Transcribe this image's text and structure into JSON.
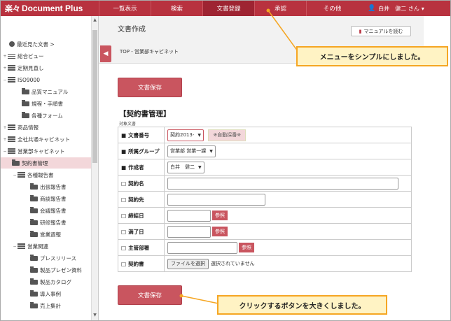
{
  "app": {
    "logo_mark": "楽々",
    "logo_text": "Document Plus"
  },
  "nav": [
    {
      "label": "一覧表示"
    },
    {
      "label": "検索"
    },
    {
      "label": "文書登録"
    },
    {
      "label": "承認"
    },
    {
      "label": "その他"
    }
  ],
  "user": {
    "name": "白井　健二 さん",
    "caret": "▾"
  },
  "sidebar": {
    "items": [
      {
        "label": "最近見た文書 >",
        "icon": "clock-icon"
      },
      {
        "label": "総合ビュー",
        "icon": "list-icon"
      },
      {
        "label": "定期見直し",
        "icon": "cabinet-icon"
      },
      {
        "label": "ISO9000",
        "icon": "cabinet-icon"
      },
      {
        "label": "品質マニュアル",
        "icon": "folder-icon"
      },
      {
        "label": "規程・手順書",
        "icon": "folder-icon"
      },
      {
        "label": "各種フォーム",
        "icon": "folder-icon"
      },
      {
        "label": "商品情報",
        "icon": "cabinet-icon"
      },
      {
        "label": "全社共通キャビネット",
        "icon": "cabinet-icon"
      },
      {
        "label": "営業部キャビネット",
        "icon": "cabinet-icon"
      },
      {
        "label": "契約書管理",
        "icon": "folder-icon"
      },
      {
        "label": "各種報告書",
        "icon": "cabinet-icon"
      },
      {
        "label": "出張報告書",
        "icon": "folder-icon"
      },
      {
        "label": "商談報告書",
        "icon": "folder-icon"
      },
      {
        "label": "会議報告書",
        "icon": "folder-icon"
      },
      {
        "label": "研修報告書",
        "icon": "folder-icon"
      },
      {
        "label": "営業週報",
        "icon": "folder-icon"
      },
      {
        "label": "営業関連",
        "icon": "cabinet-icon"
      },
      {
        "label": "プレスリリース",
        "icon": "folder-icon"
      },
      {
        "label": "製品プレゼン資料",
        "icon": "folder-icon"
      },
      {
        "label": "製品カタログ",
        "icon": "folder-icon"
      },
      {
        "label": "導入事例",
        "icon": "folder-icon"
      },
      {
        "label": "売上集計",
        "icon": "folder-icon"
      }
    ]
  },
  "main": {
    "page_title": "文書作成",
    "manual_label": "マニュアルを読む",
    "breadcrumb": "TOP - 営業部キャビネット",
    "save_label": "文書保存",
    "form_title": "【契約書管理】",
    "target_label": "対象文書",
    "fields": {
      "doc_no": {
        "label": "文書番号",
        "bullet": "■",
        "value": "契約2013-",
        "auto": "※自動採番※"
      },
      "dept": {
        "label": "所属グループ",
        "bullet": "■",
        "value": "営業部 営業一課"
      },
      "author": {
        "label": "作成者",
        "bullet": "■",
        "value": "白井　健二"
      },
      "contract_name": {
        "label": "契約名",
        "bullet": "□"
      },
      "contract_party": {
        "label": "契約先",
        "bullet": "□"
      },
      "signed_date": {
        "label": "締結日",
        "bullet": "□",
        "ref": "参照"
      },
      "expire_date": {
        "label": "満了日",
        "bullet": "□",
        "ref": "参照"
      },
      "owner_dept": {
        "label": "主管部署",
        "bullet": "□",
        "ref": "参照"
      },
      "contract_file": {
        "label": "契約書",
        "bullet": "□",
        "file_btn": "ファイルを選択",
        "file_note": "選択されていません"
      }
    }
  },
  "callouts": {
    "menu": "メニューをシンプルにしました。",
    "button": "クリックするボタンを大きくしました。"
  },
  "colors": {
    "brand": "#b8323f",
    "button": "#c9555f",
    "callout_border": "#f5a623",
    "callout_bg": "#fff3c4"
  }
}
